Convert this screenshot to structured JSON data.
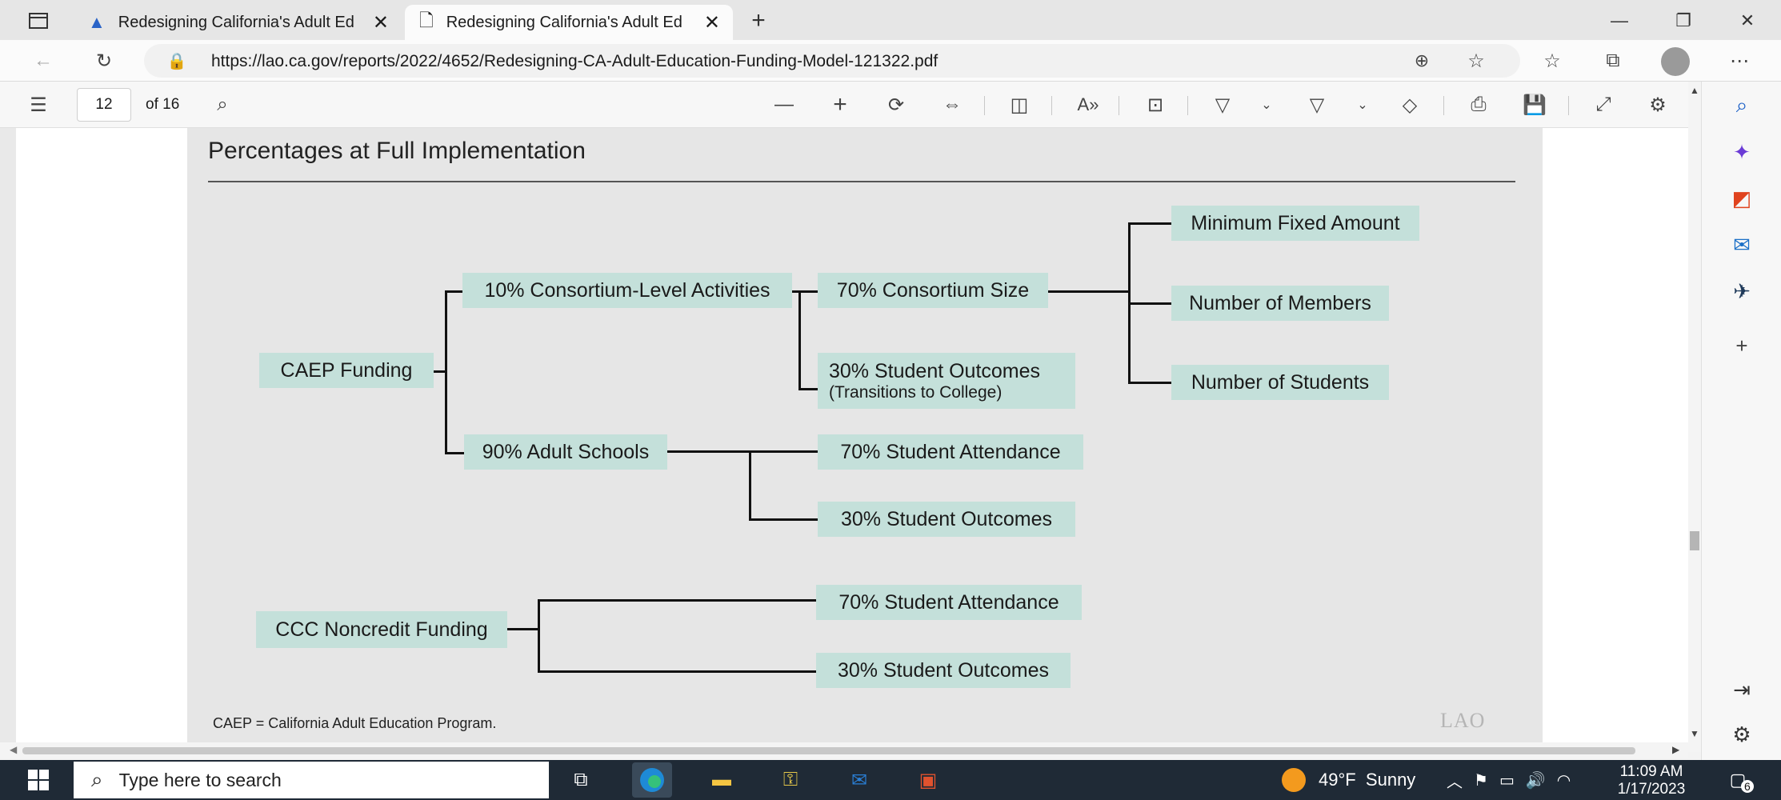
{
  "browser": {
    "tabs": [
      {
        "label": "Redesigning California's Adult Ed",
        "active": false
      },
      {
        "label": "Redesigning California's Adult Ed",
        "active": true
      }
    ],
    "url": "https://lao.ca.gov/reports/2022/4652/Redesigning-CA-Adult-Education-Funding-Model-121322.pdf"
  },
  "pdf_toolbar": {
    "page_number": "12",
    "page_total": "of 16"
  },
  "figure": {
    "title": "Percentages at Full Implementation",
    "nodes": {
      "caep": "CAEP Funding",
      "consortium": "10% Consortium-Level Activities",
      "adult_schools": "90% Adult Schools",
      "consortium_size": "70% Consortium Size",
      "student_outcomes_a": "30% Student Outcomes",
      "transitions": "(Transitions to College)",
      "min_fixed": "Minimum Fixed Amount",
      "members": "Number of Members",
      "students": "Number of Students",
      "attendance_a": "70% Student Attendance",
      "outcomes_b": "30% Student Outcomes",
      "ccc": "CCC Noncredit Funding",
      "attendance_b": "70% Student Attendance",
      "outcomes_c": "30% Student Outcomes"
    },
    "footnote": "CAEP = California Adult Education Program.",
    "watermark": "LAO"
  },
  "taskbar": {
    "search_placeholder": "Type here to search",
    "weather": "49°F  Sunny",
    "time": "11:09 AM",
    "date": "1/17/2023",
    "notifications": "6"
  }
}
